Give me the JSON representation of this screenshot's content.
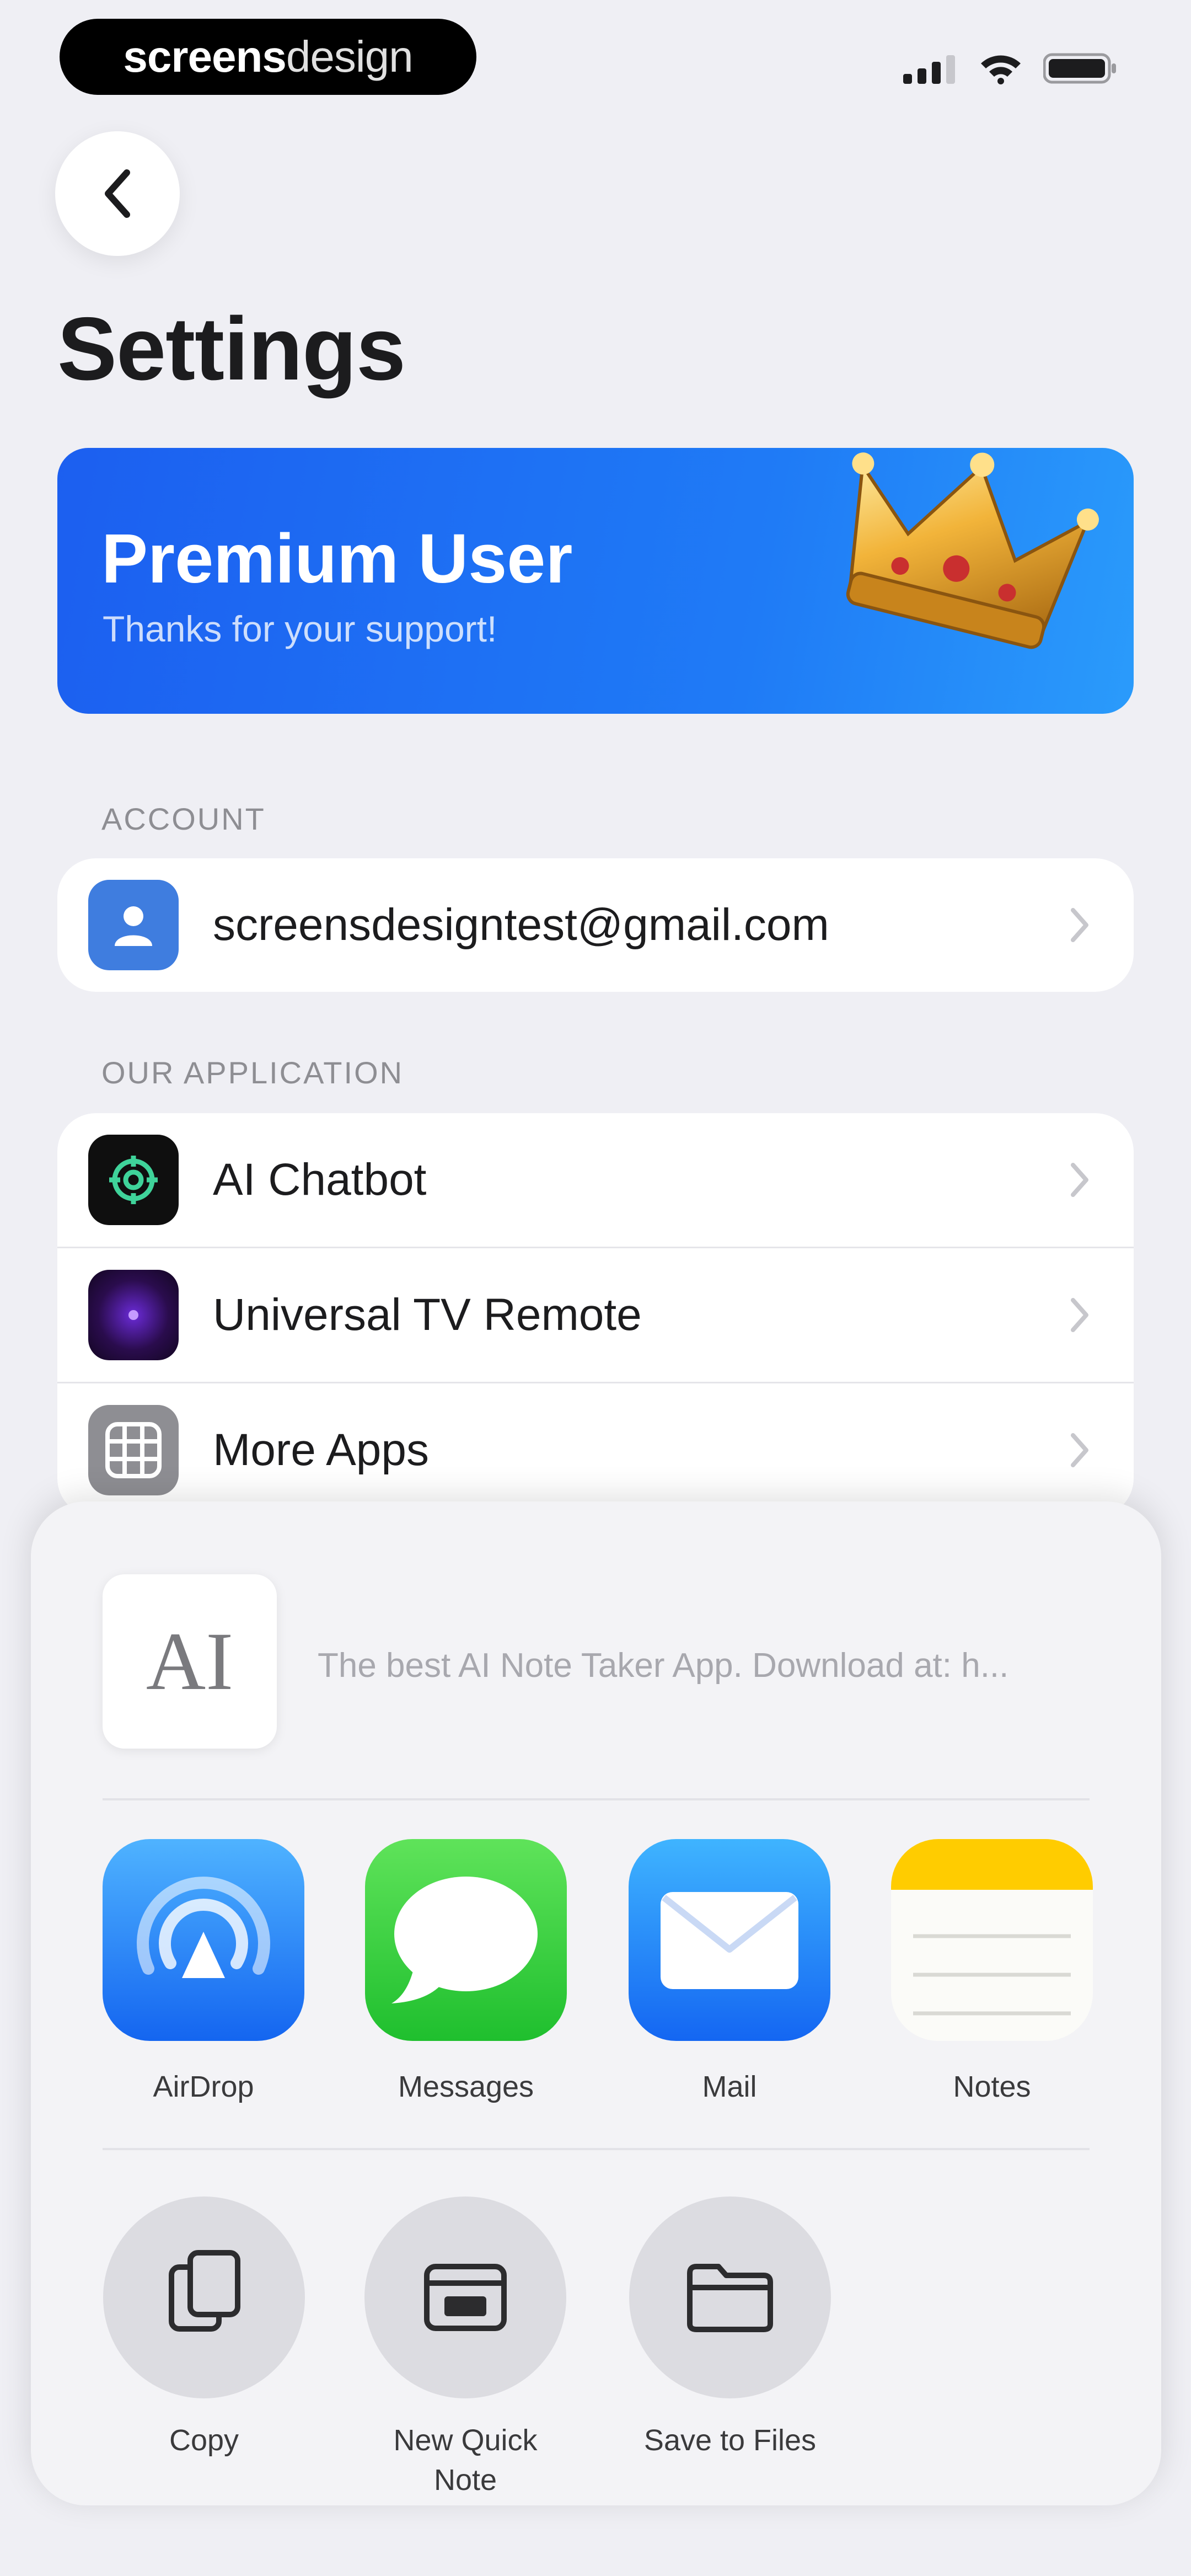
{
  "status_bar": {
    "watermark_bold": "screens",
    "watermark_light": "design",
    "signal_icon": "cellular-signal-icon",
    "wifi_icon": "wifi-icon",
    "battery_icon": "battery-icon"
  },
  "navigation": {
    "back_icon": "chevron-left-icon",
    "title": "Settings"
  },
  "premium_banner": {
    "title": "Premium User",
    "subtitle": "Thanks for your support!",
    "icon": "crown-icon",
    "color": "#1f6ff3"
  },
  "sections": {
    "account": {
      "header": "ACCOUNT",
      "rows": [
        {
          "icon": "person-icon",
          "label": "screensdesigntest@gmail.com"
        }
      ]
    },
    "our_application": {
      "header": "OUR APPLICATION",
      "rows": [
        {
          "icon": "ai-chatbot-app-icon",
          "label": "AI Chatbot"
        },
        {
          "icon": "tv-remote-app-icon",
          "label": "Universal TV Remote"
        },
        {
          "icon": "grid-icon",
          "label": "More Apps"
        }
      ]
    }
  },
  "share_sheet": {
    "preview_glyph": "AI",
    "preview_text": "The best AI Note Taker App. Download at: h...",
    "apps": [
      {
        "icon": "airdrop-icon",
        "label": "AirDrop"
      },
      {
        "icon": "messages-icon",
        "label": "Messages"
      },
      {
        "icon": "mail-icon",
        "label": "Mail"
      },
      {
        "icon": "notes-icon",
        "label": "Notes"
      }
    ],
    "actions": [
      {
        "icon": "copy-icon",
        "label": "Copy"
      },
      {
        "icon": "quick-note-icon",
        "label": "New Quick Note"
      },
      {
        "icon": "folder-icon",
        "label": "Save to Files"
      }
    ]
  },
  "colors": {
    "background": "#efeff4",
    "accent_blue": "#1f6ff3",
    "chevron": "#c7c7cc",
    "messages_green": "#34c759",
    "notes_yellow": "#ffcc00"
  }
}
